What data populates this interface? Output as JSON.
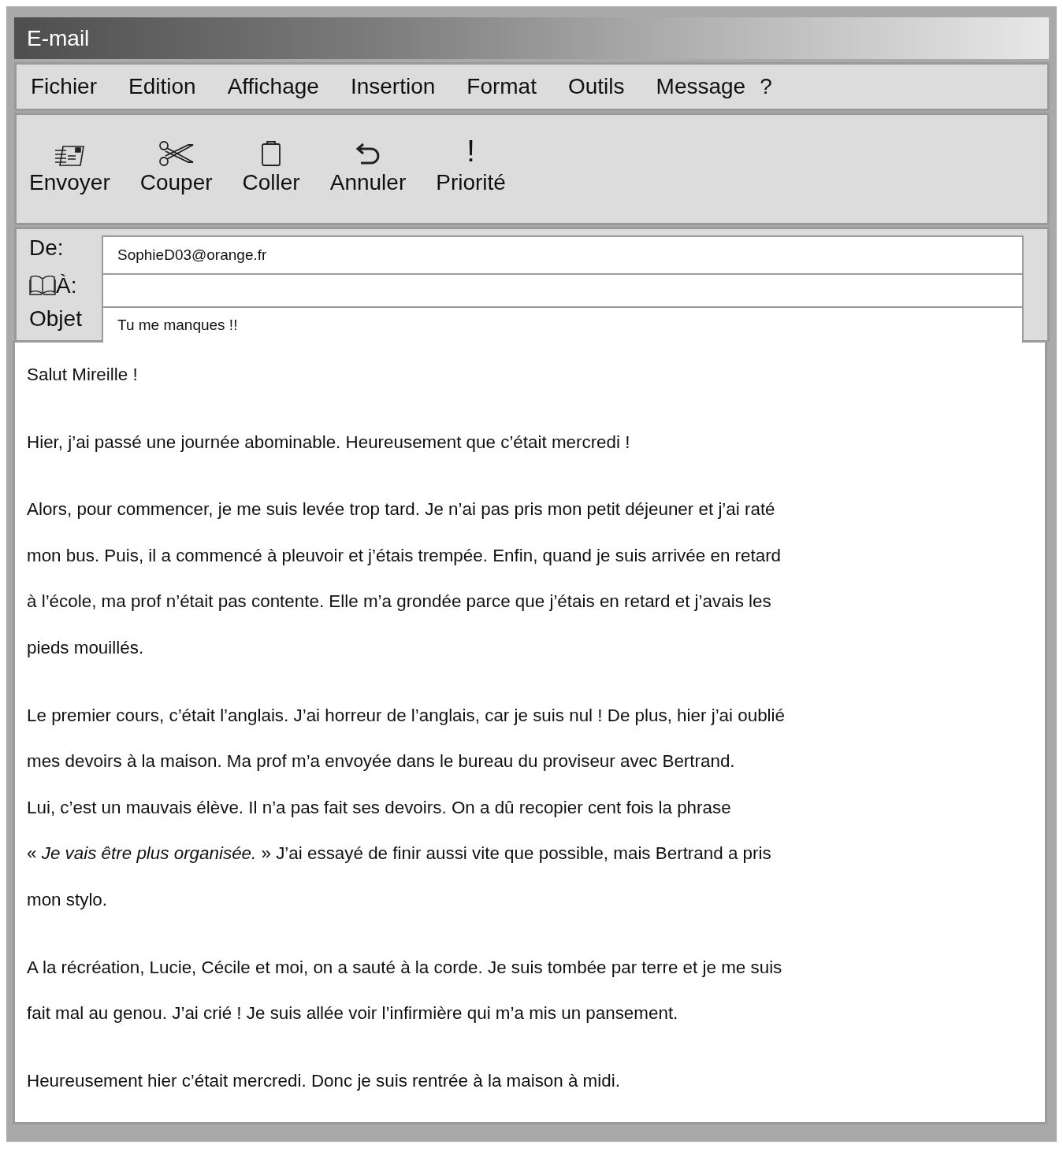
{
  "window": {
    "title": "E-mail"
  },
  "menu": [
    {
      "label": "Fichier"
    },
    {
      "label": "Edition"
    },
    {
      "label": "Affichage"
    },
    {
      "label": "Insertion"
    },
    {
      "label": "Format"
    },
    {
      "label": "Outils"
    },
    {
      "label": "Message"
    },
    {
      "label": "?"
    }
  ],
  "toolbar": [
    {
      "kind": "send",
      "label": "Envoyer"
    },
    {
      "kind": "cut",
      "label": "Couper"
    },
    {
      "kind": "paste",
      "label": "Coller"
    },
    {
      "kind": "undo",
      "label": "Annuler"
    },
    {
      "kind": "priority",
      "glyph": "!",
      "label": "Priorité"
    }
  ],
  "header": {
    "fields": [
      {
        "kind": "from",
        "label": "De:",
        "value": "SophieD03@orange.fr"
      },
      {
        "kind": "to",
        "label": "À:"
      },
      {
        "kind": "subject",
        "label": "Objet",
        "value": "Tu me manques !!"
      }
    ]
  },
  "body": {
    "paragraphs": [
      {
        "lines": [
          "Salut Mireille !"
        ]
      },
      {
        "lines": [
          "Hier, j’ai passé une journée abominable. Heureusement que c’était mercredi !"
        ]
      },
      {
        "lines": [
          "Alors, pour commencer, je me suis levée trop tard. Je n’ai pas pris mon petit déjeuner et j’ai raté",
          "mon bus. Puis, il a commencé à pleuvoir et j’étais trempée. Enfin, quand je suis arrivée en retard",
          "à l’école, ma prof n’était pas contente. Elle m’a grondée parce que j’étais en retard et j’avais les",
          "pieds mouillés."
        ]
      },
      {
        "lines": [
          "Le premier cours, c’était l’anglais. J’ai horreur de l’anglais, car je suis nul ! De plus, hier j’ai oublié",
          "mes devoirs à la maison. Ma prof m’a envoyée dans le bureau du proviseur avec Bertrand.",
          "Lui, c’est un mauvais élève. Il n’a pas fait ses devoirs. On a dû recopier cent fois la phrase",
          "« *Je vais être plus organisée.* » J’ai essayé de finir aussi vite que possible, mais Bertrand a pris",
          "mon stylo."
        ]
      },
      {
        "lines": [
          "A la récréation, Lucie, Cécile et moi, on a sauté à la corde. Je suis tombée par terre et je me suis",
          "fait mal au genou. J’ai crié ! Je suis allée voir l’infirmière qui m’a mis un pansement."
        ]
      },
      {
        "lines": [
          "Heureusement hier c’était mercredi. Donc je suis rentrée à la maison à midi."
        ]
      }
    ]
  }
}
